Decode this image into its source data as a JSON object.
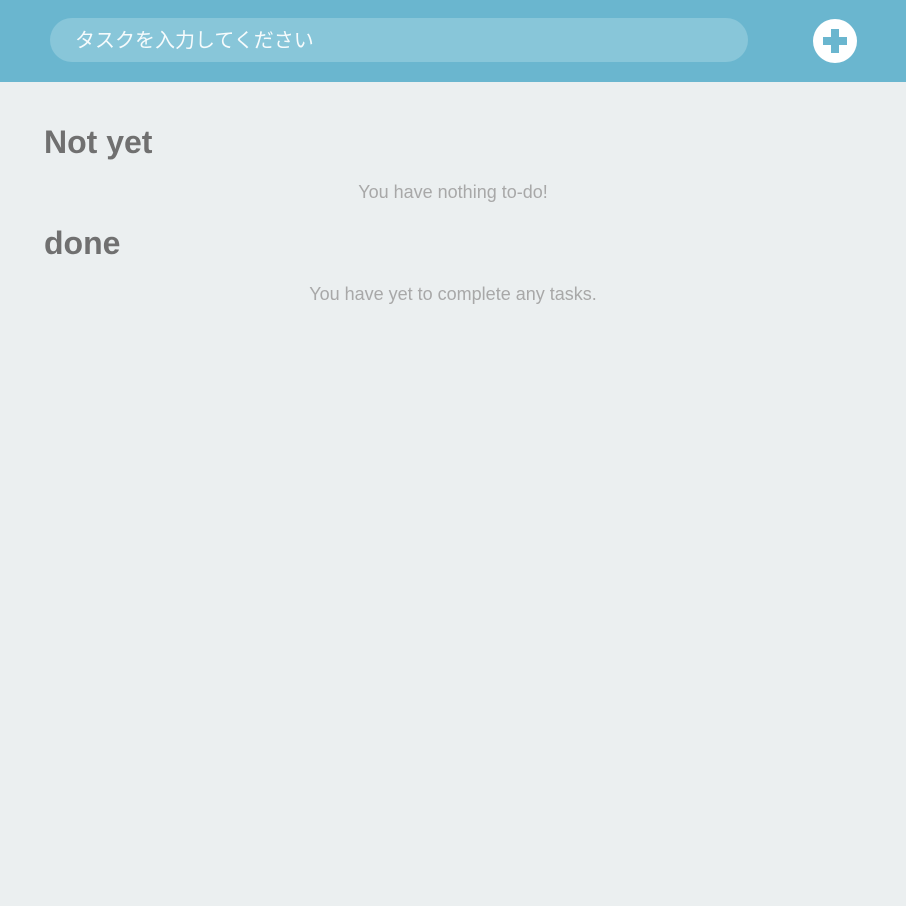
{
  "header": {
    "input_placeholder": "タスクを入力してください",
    "input_value": "",
    "add_icon": "plus-circle-icon",
    "accent_color": "#6ab6cf"
  },
  "sections": {
    "not_yet": {
      "title": "Not yet",
      "empty_message": "You have nothing to-do!"
    },
    "done": {
      "title": "done",
      "empty_message": "You have yet to complete any tasks."
    }
  }
}
